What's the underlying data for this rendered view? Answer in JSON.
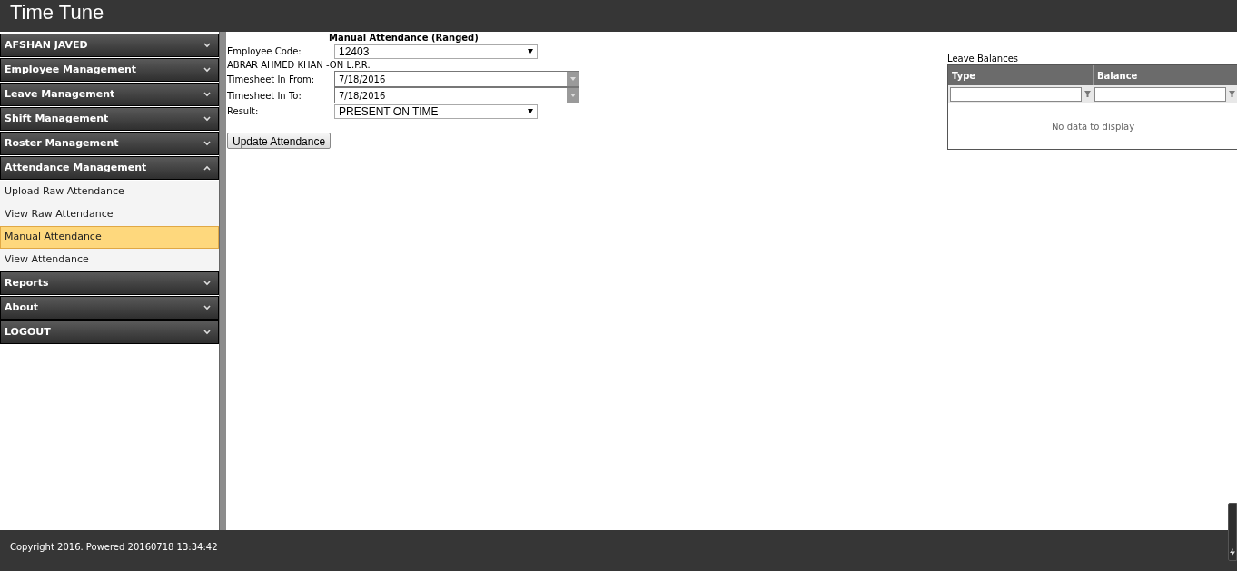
{
  "header": {
    "title": "Time Tune"
  },
  "sidebar": {
    "items": [
      {
        "label": "AFSHAN JAVED",
        "expanded": false
      },
      {
        "label": "Employee Management",
        "expanded": false
      },
      {
        "label": "Leave Management",
        "expanded": false
      },
      {
        "label": "Shift Management",
        "expanded": false
      },
      {
        "label": "Roster Management",
        "expanded": false
      },
      {
        "label": "Attendance Management",
        "expanded": true,
        "children": [
          {
            "label": "Upload Raw Attendance",
            "selected": false
          },
          {
            "label": "View Raw Attendance",
            "selected": false
          },
          {
            "label": "Manual Attendance",
            "selected": true
          },
          {
            "label": "View Attendance",
            "selected": false
          }
        ]
      },
      {
        "label": "Reports",
        "expanded": false
      },
      {
        "label": "About",
        "expanded": false
      },
      {
        "label": "LOGOUT",
        "expanded": false
      }
    ]
  },
  "form": {
    "title": "Manual Attendance (Ranged)",
    "fields": [
      {
        "kind": "select",
        "label": "Employee Code:",
        "value": "12403"
      },
      {
        "kind": "note",
        "label": "ABRAR AHMED KHAN -ON L.P.R."
      },
      {
        "kind": "date",
        "label": "Timesheet In From:",
        "value": "7/18/2016"
      },
      {
        "kind": "date",
        "label": "Timesheet In To:",
        "value": "7/18/2016"
      },
      {
        "kind": "select",
        "label": "Result:",
        "value": "PRESENT ON TIME"
      }
    ],
    "button": "Update Attendance"
  },
  "leave_balances": {
    "title": "Leave Balances",
    "columns": [
      "Type",
      "Balance"
    ],
    "empty_text": "No data to display"
  },
  "footer": {
    "text": "Copyright 2016. Powered 20160718 13:34:42"
  }
}
